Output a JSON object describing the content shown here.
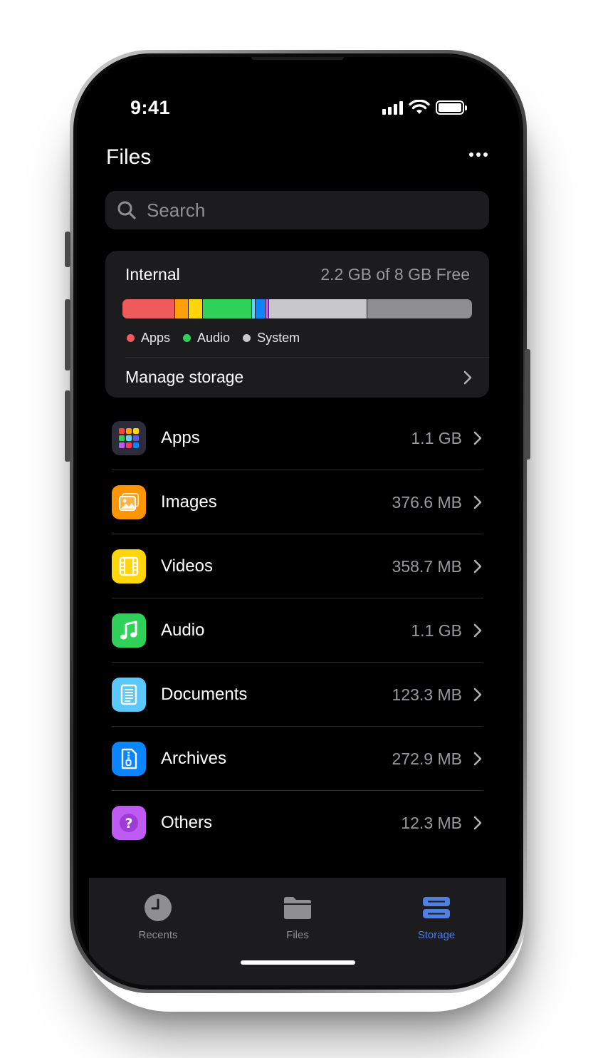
{
  "status_bar": {
    "time": "9:41"
  },
  "header": {
    "title": "Files",
    "more_icon": "more-horizontal-icon"
  },
  "search": {
    "placeholder": "Search",
    "icon": "search-icon"
  },
  "storage": {
    "name": "Internal",
    "free_text": "2.2 GB of 8 GB Free",
    "segments": [
      {
        "color": "#f05a5a",
        "fraction": 0.15
      },
      {
        "color": "#ff9f0a",
        "fraction": 0.04
      },
      {
        "color": "#ffd60a",
        "fraction": 0.04
      },
      {
        "color": "#30d158",
        "fraction": 0.14
      },
      {
        "color": "#64d2ff",
        "fraction": 0.01
      },
      {
        "color": "#0a84ff",
        "fraction": 0.03
      },
      {
        "color": "#bf5af2",
        "fraction": 0.01
      },
      {
        "color": "#c7c7cc",
        "fraction": 0.28
      }
    ],
    "legend": [
      {
        "label": "Apps",
        "color": "#f05a5a"
      },
      {
        "label": "Audio",
        "color": "#30d158"
      },
      {
        "label": "System",
        "color": "#c7c7cc"
      }
    ],
    "manage_label": "Manage storage"
  },
  "categories": [
    {
      "label": "Apps",
      "size": "1.1 GB",
      "color": "#2c2c3a",
      "icon": "apps-grid-icon"
    },
    {
      "label": "Images",
      "size": "376.6 MB",
      "color": "#ff9500",
      "icon": "image-icon"
    },
    {
      "label": "Videos",
      "size": "358.7 MB",
      "color": "#ffd60a",
      "icon": "film-icon"
    },
    {
      "label": "Audio",
      "size": "1.1 GB",
      "color": "#30d158",
      "icon": "music-note-icon"
    },
    {
      "label": "Documents",
      "size": "123.3 MB",
      "color": "#5ac8fa",
      "icon": "document-icon"
    },
    {
      "label": "Archives",
      "size": "272.9 MB",
      "color": "#0a84ff",
      "icon": "archive-zip-icon"
    },
    {
      "label": "Others",
      "size": "12.3 MB",
      "color": "#bf5af2",
      "icon": "question-icon"
    }
  ],
  "tabs": [
    {
      "label": "Recents",
      "icon": "clock-icon",
      "active": false
    },
    {
      "label": "Files",
      "icon": "folder-icon",
      "active": false
    },
    {
      "label": "Storage",
      "icon": "storage-icon",
      "active": true
    }
  ],
  "colors": {
    "accent": "#4f7fe0",
    "background": "#000000",
    "card": "#1c1c1e"
  }
}
